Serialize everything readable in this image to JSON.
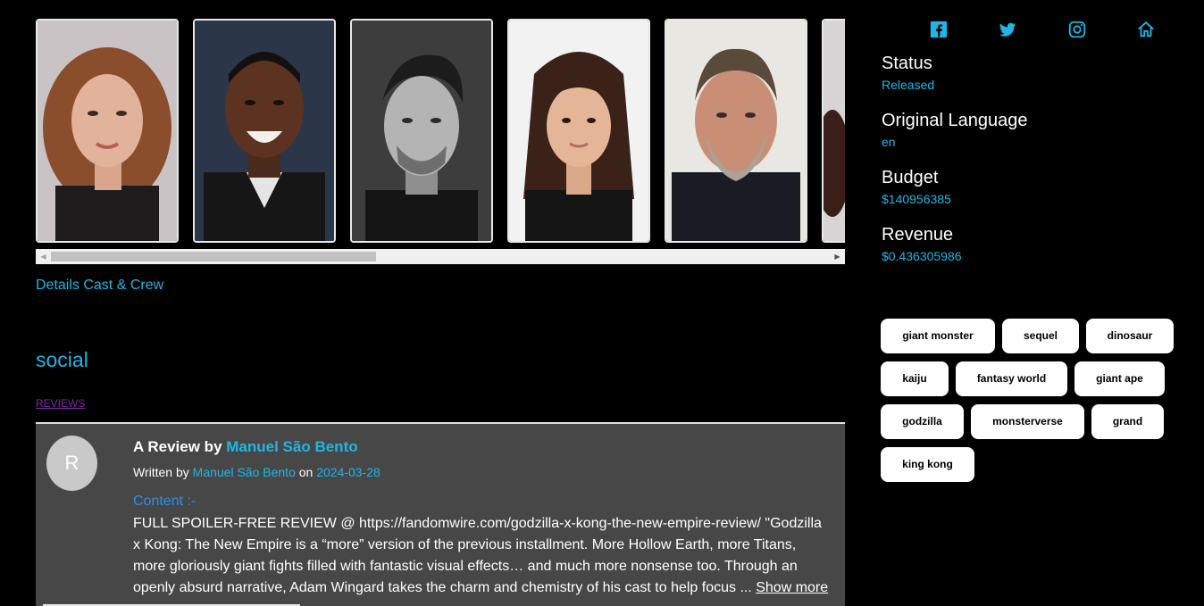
{
  "cast": [
    {
      "photo": "cast-photo-woman-curly-hair"
    },
    {
      "photo": "cast-photo-man-smiling"
    },
    {
      "photo": "cast-photo-man-black-white"
    },
    {
      "photo": "cast-photo-girl"
    },
    {
      "photo": "cast-photo-man-beard"
    },
    {
      "photo": "cast-photo-partial"
    }
  ],
  "details_link": "Details Cast & Crew",
  "social": {
    "heading": "social",
    "tab_reviews": "REVIEWS"
  },
  "review": {
    "avatar_letter": "R",
    "title_prefix": "A Review by",
    "author": "Manuel São Bento",
    "written_by_prefix": "Written by",
    "on_label": "on",
    "date": "2024-03-28",
    "content_label": "Content :-",
    "body": "FULL SPOILER-FREE REVIEW @ https://fandomwire.com/godzilla-x-kong-the-new-empire-review/ \"Godzilla x Kong: The New Empire is a “more” version of the previous installment. More Hollow Earth, more Titans, more gloriously giant fights filled with fantastic visual effects… and much more nonsense too. Through an openly absurd narrative, Adam Wingard takes the charm and chemistry of his cast to help focus ... ",
    "show_more": "Show more"
  },
  "social_icons": [
    "facebook-icon",
    "twitter-icon",
    "instagram-icon",
    "home-icon"
  ],
  "info": {
    "status_label": "Status",
    "status_value": "Released",
    "language_label": "Original Language",
    "language_value": "en",
    "budget_label": "Budget",
    "budget_value": "$140956385",
    "revenue_label": "Revenue",
    "revenue_value": "$0.436305986"
  },
  "keywords": [
    "giant monster",
    "sequel",
    "dinosaur",
    "kaiju",
    "fantasy world",
    "giant ape",
    "godzilla",
    "monsterverse",
    "grand",
    "king kong"
  ],
  "colors": {
    "accent": "#1fb6e6",
    "review_bg": "#474747",
    "tag_bg": "#ffffff",
    "visited_link": "#7a2ca8"
  }
}
